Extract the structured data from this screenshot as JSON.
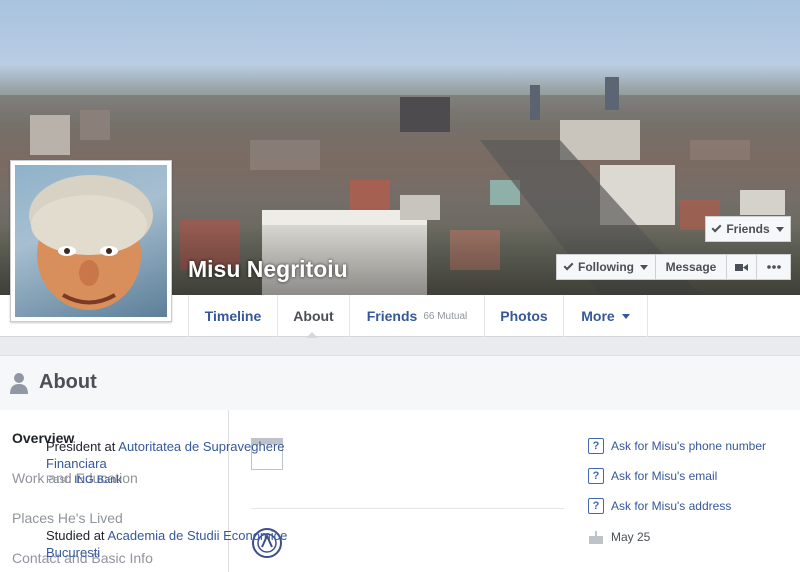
{
  "profile": {
    "name": "Misu Negritoiu"
  },
  "cover_actions": {
    "friends_label": "Friends",
    "following_label": "Following",
    "message_label": "Message"
  },
  "nav": {
    "tabs": [
      {
        "label": "Timeline"
      },
      {
        "label": "About"
      },
      {
        "label": "Friends",
        "badge": "66 Mutual"
      },
      {
        "label": "Photos"
      },
      {
        "label": "More"
      }
    ]
  },
  "about": {
    "title": "About",
    "sidebar": [
      {
        "label": "Overview"
      },
      {
        "label": "Work and Education"
      },
      {
        "label": "Places He's Lived"
      },
      {
        "label": "Contact and Basic Info"
      }
    ],
    "work": {
      "prefix": "President at ",
      "employer": "Autoritatea de Supraveghere Financiara",
      "past_prefix": "Past: ",
      "past": "ING Bank"
    },
    "education": {
      "prefix": "Studied at ",
      "school": "Academia de Studii Economice Bucuresti"
    },
    "ask": [
      {
        "label": "Ask for Misu's phone number"
      },
      {
        "label": "Ask for Misu's email"
      },
      {
        "label": "Ask for Misu's address"
      }
    ],
    "birthday": "May 25"
  },
  "colors": {
    "link": "#365899",
    "background": "#e9ebee",
    "muted": "#90949c"
  }
}
